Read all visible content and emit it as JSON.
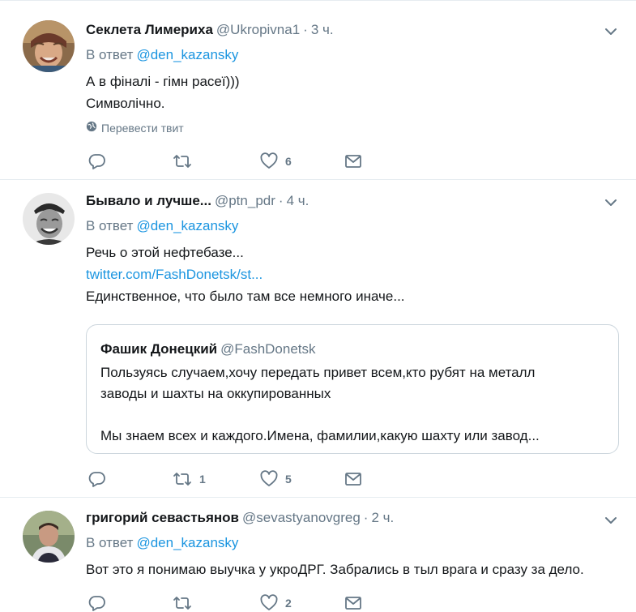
{
  "tweets": [
    {
      "fullname": "Секлета Лимериха",
      "handle": "@Ukropivna1",
      "sep": "·",
      "time": "3 ч.",
      "reply_prefix": "В ответ",
      "reply_mention": "@den_kazansky",
      "lines": [
        "А в фіналі - гімн расеї)))",
        "Символічно."
      ],
      "translate_label": "Перевести твит",
      "replies": "",
      "retweets": "",
      "likes": "6"
    },
    {
      "fullname": "Бывало и лучше...",
      "handle": "@ptn_pdr",
      "sep": "·",
      "time": "4 ч.",
      "reply_prefix": "В ответ",
      "reply_mention": "@den_kazansky",
      "line1": "Речь о этой нефтебазе...",
      "link": "twitter.com/FashDonetsk/st...",
      "line3": "Единственное, что было там все немного иначе...",
      "quote": {
        "name": "Фашик Донецкий",
        "handle": "@FashDonetsk",
        "lines": [
          "Пользуясь случаем,хочу передать привет всем,кто рубят на металл",
          "заводы и шахты на оккупированных",
          "",
          "Мы знаем всех и каждого.Имена, фамилии,какую шахту или завод..."
        ]
      },
      "replies": "",
      "retweets": "1",
      "likes": "5"
    },
    {
      "fullname": "григорий севастьянов",
      "handle": "@sevastyanovgreg",
      "sep": "·",
      "time": "2 ч.",
      "reply_prefix": "В ответ",
      "reply_mention": "@den_kazansky",
      "lines": [
        "Вот это я понимаю выучка у укроДРГ. Забрались в тыл врага и сразу за дело."
      ],
      "replies": "",
      "retweets": "",
      "likes": "2"
    }
  ],
  "icons": {
    "reply": "reply-icon",
    "retweet": "retweet-icon",
    "like": "heart-icon",
    "dm": "envelope-icon",
    "caret": "chevron-down-icon",
    "globe": "globe-icon"
  },
  "colors": {
    "text": "#14171a",
    "secondary": "#657786",
    "link": "#1b95e0",
    "border": "#e6ecf0"
  }
}
